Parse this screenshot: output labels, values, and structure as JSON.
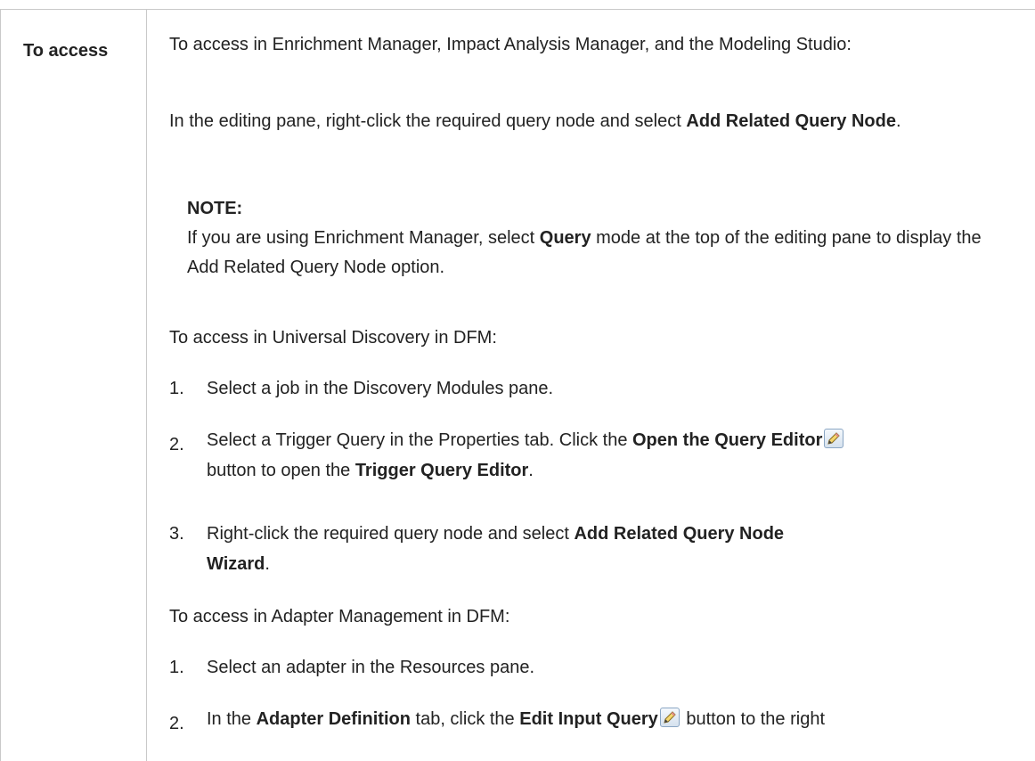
{
  "row_label": "To access",
  "intro": "To access in Enrichment Manager, Impact Analysis Manager, and the Modeling Studio:",
  "editing_pane": {
    "before": "In the editing pane, right-click the required query node and select ",
    "bold": "Add Related Query Node",
    "after": "."
  },
  "note": {
    "title": "NOTE:",
    "before": "If you are using Enrichment Manager, select ",
    "bold": "Query",
    "after": " mode at the top of the editing pane to display the Add Related Query Node option."
  },
  "ud_heading": "To access in Universal Discovery in DFM:",
  "ud_steps": [
    {
      "num": "1.",
      "text": "Select a job in the Discovery Modules pane."
    },
    {
      "num": "2.",
      "t1": "Select a Trigger Query in the Properties tab. Click the ",
      "b1": "Open the Query Editor",
      "t2": " button to open the ",
      "b2": "Trigger Query Editor",
      "t3": "."
    },
    {
      "num": "3.",
      "t1": "Right-click the required query node and select ",
      "b1": "Add Related Query Node Wizard",
      "t2": "."
    }
  ],
  "am_heading": "To access in Adapter Management in DFM:",
  "am_steps": [
    {
      "num": "1.",
      "text": "Select an adapter in the Resources pane."
    },
    {
      "num": "2.",
      "t1": "In the ",
      "b1": "Adapter Definition",
      "t2": " tab, click the ",
      "b2": "Edit Input Query",
      "t3": " button to the right"
    }
  ],
  "icons": {
    "edit": "pencil-edit-icon"
  }
}
